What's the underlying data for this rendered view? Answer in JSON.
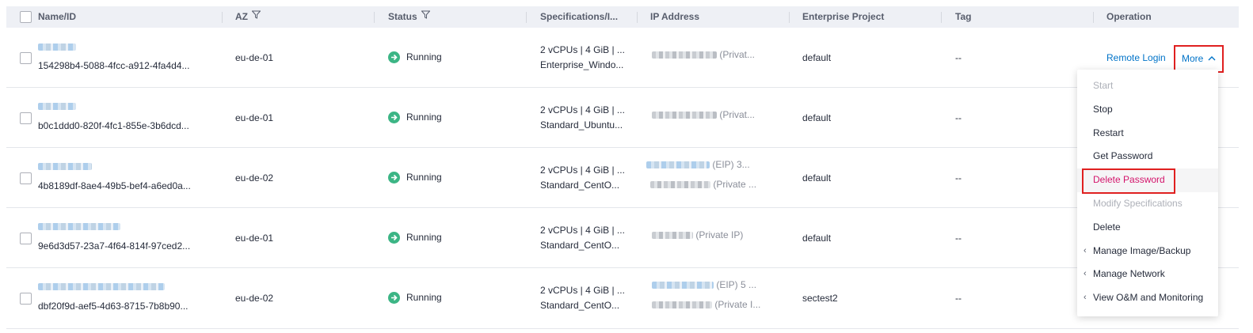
{
  "columns": {
    "name": "Name/ID",
    "az": "AZ",
    "status": "Status",
    "specs": "Specifications/I...",
    "ip": "IP Address",
    "project": "Enterprise Project",
    "tag": "Tag",
    "operation": "Operation"
  },
  "rows": [
    {
      "id": "154298b4-5088-4fcc-a912-4fa4d4...",
      "az": "eu-de-01",
      "status": "Running",
      "spec1": "2 vCPUs | 4 GiB | ...",
      "spec2": "Enterprise_Windo...",
      "ip1_label": "(Privat...",
      "ip2_label": "",
      "project": "default",
      "tag": "--"
    },
    {
      "id": "b0c1ddd0-820f-4fc1-855e-3b6dcd...",
      "az": "eu-de-01",
      "status": "Running",
      "spec1": "2 vCPUs | 4 GiB | ...",
      "spec2": "Standard_Ubuntu...",
      "ip1_label": "(Privat...",
      "ip2_label": "",
      "project": "default",
      "tag": "--"
    },
    {
      "id": "4b8189df-8ae4-49b5-bef4-a6ed0a...",
      "az": "eu-de-02",
      "status": "Running",
      "spec1": "2 vCPUs | 4 GiB | ...",
      "spec2": "Standard_CentO...",
      "ip1_label": "(EIP) 3...",
      "ip2_label": "(Private ...",
      "project": "default",
      "tag": "--"
    },
    {
      "id": "9e6d3d57-23a7-4f64-814f-97ced2...",
      "az": "eu-de-01",
      "status": "Running",
      "spec1": "2 vCPUs | 4 GiB | ...",
      "spec2": "Standard_CentO...",
      "ip1_label": "(Private IP)",
      "ip2_label": "",
      "project": "default",
      "tag": "--"
    },
    {
      "id": "dbf20f9d-aef5-4d63-8715-7b8b90...",
      "az": "eu-de-02",
      "status": "Running",
      "spec1": "2 vCPUs | 4 GiB | ...",
      "spec2": "Standard_CentO...",
      "ip1_label": "(EIP) 5 ...",
      "ip2_label": "(Private I...",
      "project": "sectest2",
      "tag": "--"
    }
  ],
  "operation": {
    "remote_login": "Remote Login",
    "more": "More"
  },
  "dropdown": [
    {
      "label": "Start",
      "state": "disabled"
    },
    {
      "label": "Stop",
      "state": "normal"
    },
    {
      "label": "Restart",
      "state": "normal"
    },
    {
      "label": "Get Password",
      "state": "normal"
    },
    {
      "label": "Delete Password",
      "state": "highlighted"
    },
    {
      "label": "Modify Specifications",
      "state": "disabled"
    },
    {
      "label": "Delete",
      "state": "normal"
    },
    {
      "label": "Manage Image/Backup",
      "state": "submenu"
    },
    {
      "label": "Manage Network",
      "state": "submenu"
    },
    {
      "label": "View O&M and Monitoring",
      "state": "submenu"
    }
  ],
  "colors": {
    "running": "#3cb585",
    "link": "#0073c8",
    "danger": "#d4146b",
    "highlight_box": "#e02020",
    "header_bg": "#eef0f5"
  },
  "icons": {
    "filter": "filter-icon",
    "status": "running-status-icon",
    "chevron_up": "chevron-up-icon",
    "chevron_left": "chevron-left-icon"
  }
}
